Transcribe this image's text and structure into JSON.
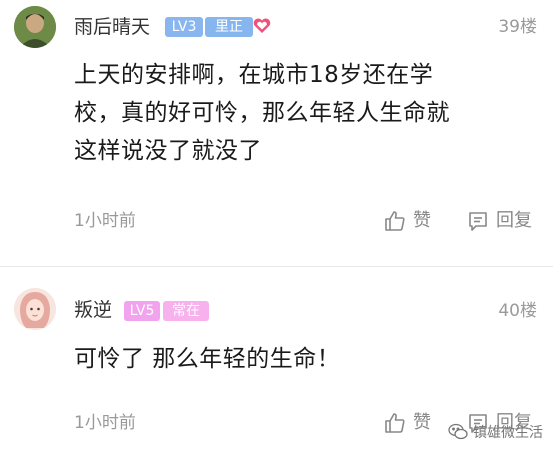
{
  "comments": [
    {
      "username": "雨后晴天",
      "level": "LV3",
      "tag": "里正",
      "floor": "39楼",
      "content": "上天的安排啊，在城市18岁还在学\n校，真的好可怜，那么年轻人生命就\n这样说没了就没了",
      "time": "1小时前",
      "like_label": "赞",
      "reply_label": "回复"
    },
    {
      "username": "叛逆",
      "level": "LV5",
      "tag": "常在",
      "floor": "40楼",
      "content": "可怜了  那么年轻的生命！",
      "time": "1小时前",
      "like_label": "赞",
      "reply_label": "回复"
    }
  ],
  "watermark": "镇雄微生活",
  "icons": {
    "heart": "heart-icon",
    "like": "thumbs-up-icon",
    "reply": "comment-icon",
    "watermark": "wechat-icon"
  },
  "colors": {
    "level_badge_blue": "#8ab6ef",
    "level_badge_pink": "#f2a3ee",
    "heart": "#f0507a",
    "muted_text": "#999999"
  }
}
